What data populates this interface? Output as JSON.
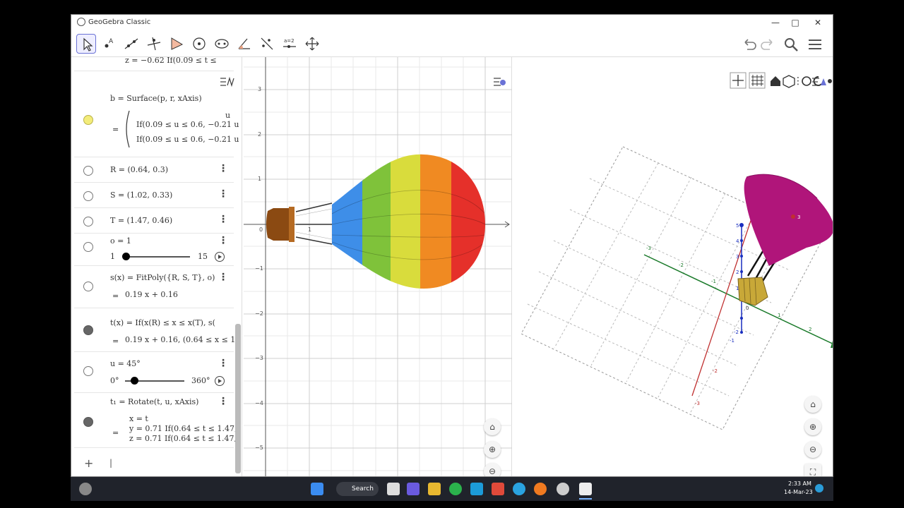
{
  "window": {
    "title": "GeoGebra Classic",
    "minimize": "—",
    "maximize": "□",
    "close": "✕"
  },
  "toolbar": {
    "tools": [
      "move-tool",
      "point-tool",
      "line-tool",
      "perpendicular-tool",
      "polygon-tool",
      "circle-tool",
      "conic-tool",
      "angle-tool",
      "reflect-tool",
      "slider-tool",
      "move-view-tool"
    ],
    "slider_tool_label": "a=2",
    "right": [
      "undo-icon",
      "redo-icon",
      "search-icon",
      "menu-icon"
    ]
  },
  "algebra": {
    "top_partial": "z = −0.62 If(0.09 ≤ t ≤",
    "b": {
      "def": "b = Surface(p, r, xAxis)",
      "line0": "u",
      "line1": "If(0.09 ≤ u ≤ 0.6, −0.21 u",
      "line2": "If(0.09 ≤ u ≤ 0.6, −0.21 u",
      "eq": "="
    },
    "R": "R = (0.64, 0.3)",
    "S": "S = (1.02, 0.33)",
    "T": "T = (1.47, 0.46)",
    "o": {
      "def": "o = 1",
      "min": "1",
      "max": "15",
      "value": 1
    },
    "s": {
      "def": "s(x) = FitPoly({R, S, T}, o)",
      "result": "0.19 x + 0.16",
      "eq": "="
    },
    "t": {
      "def": "t(x) = If(x(R) ≤ x ≤ x(T), s(",
      "result": "0.19 x + 0.16,     (0.64 ≤ x ≤ 1",
      "eq": "="
    },
    "u": {
      "def": "u = 45°",
      "min": "0°",
      "max": "360°",
      "value": 45
    },
    "t1": {
      "def": "t₁ = Rotate(t, u, xAxis)",
      "line1": "x = t",
      "line2": "y = 0.71 If(0.64 ≤ t ≤ 1.47,",
      "line3": "z = 0.71 If(0.64 ≤ t ≤ 1.47,",
      "eq": "="
    },
    "input_plus": "+",
    "input_caret": "|",
    "kebab": "⋮"
  },
  "graphics2d": {
    "y_ticks": [
      "3",
      "2",
      "1",
      "−1",
      "−2",
      "−3",
      "−4",
      "−5"
    ],
    "x_ticks": [
      "0",
      "1"
    ],
    "balloon_colors": [
      "#3e8ee8",
      "#7fc23a",
      "#d9dc3c",
      "#f08a22",
      "#e5302a"
    ],
    "basket_color": "#8b4a12"
  },
  "graphics3d": {
    "surface_color": "#b0157a",
    "basket_color": "#c8a838",
    "x_axis_labels": [
      "-3",
      "-2",
      "-1",
      "1",
      "2",
      "3"
    ],
    "y_axis_labels": [
      "-3",
      "-2",
      "1",
      "2",
      "3"
    ],
    "z_axis_labels": [
      "5",
      "4",
      "3",
      "2",
      "1",
      "-1",
      "-2"
    ],
    "surface_label": "3",
    "origin_label": "0"
  },
  "taskbar": {
    "search_label": "Search",
    "time": "2:33 AM",
    "date": "14-Mar-23"
  }
}
